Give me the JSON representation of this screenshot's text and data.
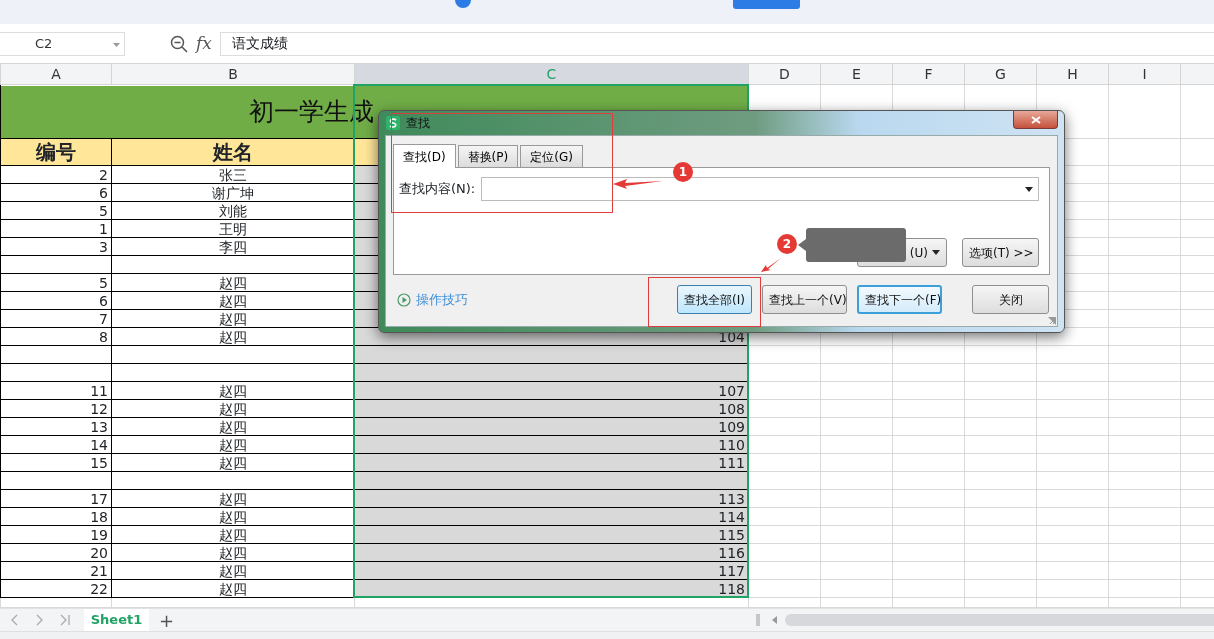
{
  "formula_bar": {
    "cell_ref": "C2",
    "fx": "fx",
    "value": "语文成绩"
  },
  "columns": [
    {
      "label": "A",
      "selected": false
    },
    {
      "label": "B",
      "selected": false
    },
    {
      "label": "C",
      "selected": true
    },
    {
      "label": "D",
      "selected": false
    },
    {
      "label": "E",
      "selected": false
    },
    {
      "label": "F",
      "selected": false
    },
    {
      "label": "G",
      "selected": false
    },
    {
      "label": "H",
      "selected": false
    },
    {
      "label": "I",
      "selected": false
    }
  ],
  "title": "初一学生成",
  "header": [
    "编号",
    "姓名"
  ],
  "rows": [
    {
      "no": "2",
      "name": "张三"
    },
    {
      "no": "6",
      "name": "谢广坤"
    },
    {
      "no": "5",
      "name": "刘能"
    },
    {
      "no": "1",
      "name": "王明"
    },
    {
      "no": "3",
      "name": "李四"
    },
    {},
    {
      "no": "5",
      "name": "赵四"
    },
    {
      "no": "6",
      "name": "赵四"
    },
    {
      "no": "7",
      "name": "赵四"
    },
    {
      "no": "8",
      "name": "赵四",
      "score": "104"
    },
    {},
    {},
    {
      "no": "11",
      "name": "赵四",
      "score": "107"
    },
    {
      "no": "12",
      "name": "赵四",
      "score": "108"
    },
    {
      "no": "13",
      "name": "赵四",
      "score": "109"
    },
    {
      "no": "14",
      "name": "赵四",
      "score": "110"
    },
    {
      "no": "15",
      "name": "赵四",
      "score": "111"
    },
    {},
    {
      "no": "17",
      "name": "赵四",
      "score": "113"
    },
    {
      "no": "18",
      "name": "赵四",
      "score": "114"
    },
    {
      "no": "19",
      "name": "赵四",
      "score": "115"
    },
    {
      "no": "20",
      "name": "赵四",
      "score": "116"
    },
    {
      "no": "21",
      "name": "赵四",
      "score": "117"
    },
    {
      "no": "22",
      "name": "赵四",
      "score": "118"
    }
  ],
  "sheet_tabs": [
    {
      "label": "Sheet1",
      "selected": true
    }
  ],
  "add_sheet": "+",
  "dialog": {
    "title": "查找",
    "tabs": [
      {
        "label": "查找(D)",
        "selected": true
      },
      {
        "label": "替换(P)",
        "selected": false
      },
      {
        "label": "定位(G)",
        "selected": false
      }
    ],
    "find_label": "查找内容(N):",
    "scope_button": "(U)",
    "options_button": "选项(T) >>",
    "tips_link": "操作技巧",
    "buttons": [
      {
        "label": "查找全部(I)",
        "kind": "hover"
      },
      {
        "label": "查找上一个(V)",
        "kind": "normal"
      },
      {
        "label": "查找下一个(F)",
        "kind": "default"
      },
      {
        "label": "关闭",
        "kind": "normal"
      }
    ]
  },
  "annotations": [
    {
      "label": "1"
    },
    {
      "label": "2"
    }
  ]
}
